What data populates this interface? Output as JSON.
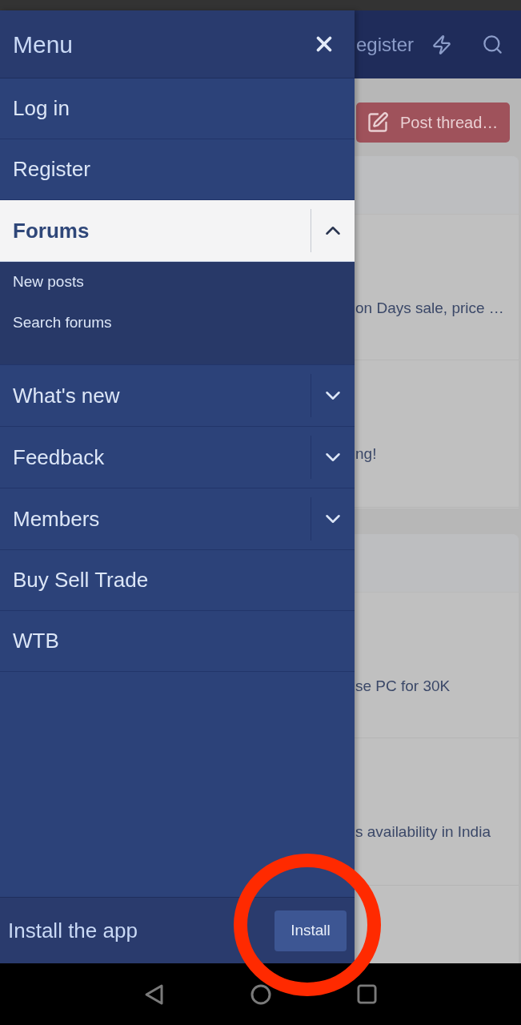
{
  "drawer": {
    "title": "Menu",
    "items": [
      {
        "label": "Log in",
        "kind": "link",
        "selected": false
      },
      {
        "label": "Register",
        "kind": "link",
        "selected": false
      },
      {
        "label": "Forums",
        "kind": "group",
        "selected": true,
        "expanded": true,
        "children": [
          {
            "label": "New posts"
          },
          {
            "label": "Search forums"
          }
        ]
      },
      {
        "label": "What's new",
        "kind": "group",
        "selected": false,
        "expanded": false
      },
      {
        "label": "Feedback",
        "kind": "group",
        "selected": false,
        "expanded": false
      },
      {
        "label": "Members",
        "kind": "group",
        "selected": false,
        "expanded": false
      },
      {
        "label": "Buy Sell Trade",
        "kind": "link",
        "selected": false
      },
      {
        "label": "WTB",
        "kind": "link",
        "selected": false
      }
    ],
    "install_bar": {
      "text": "Install the app",
      "button": "Install"
    }
  },
  "page": {
    "header_link": "egister",
    "post_button": "Post thread…",
    "cards": [
      {
        "rows": [
          "on Days sale, price …",
          "ng!"
        ]
      },
      {
        "rows": [
          "se PC for 30K",
          "s availability in India"
        ]
      }
    ]
  }
}
